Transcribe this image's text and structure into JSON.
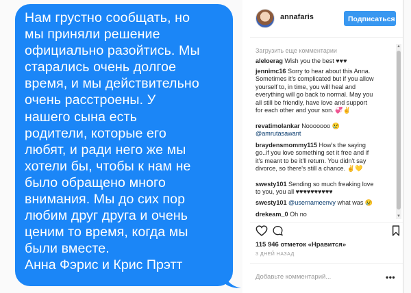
{
  "message": {
    "lines": [
      "Нам грустно сообщать, но",
      "мы приняли решение",
      "официально разойтись. Мы",
      "старались очень долгое",
      "время, и мы действительно",
      "очень расстроены. У",
      "нашего сына есть",
      "родители, которые его",
      "любят, и ради него же мы",
      "хотели бы, чтобы к нам не",
      "было обращено много",
      "внимания. Мы до сих пор",
      "любим друг друга и очень",
      "ценим то время, когда мы",
      "были вместе."
    ],
    "signature": "Анна Фэрис и Крис Прэтт",
    "bubble_color": "#1b86f7"
  },
  "post": {
    "username": "annafaris",
    "follow_label": "Подписаться",
    "load_more": "Загрузить еще комментарии",
    "comments": [
      {
        "user": "aleloerag",
        "lines": [
          "Wish you the best ♥♥♥"
        ]
      },
      {
        "user": "jennimc16",
        "lines": [
          "Sorry to hear about this Anna.",
          "Sometimes it's complicated but if you allow",
          "yourself to, in time, you will heal and",
          "everything will go back to normal. May you",
          "all still be friendly, have love and support",
          "for each other and your son. 💞✌"
        ]
      },
      {
        "user": "revatimolankar",
        "lines": [
          "Nooooooo 😢"
        ],
        "mention": "@amrutasawant"
      },
      {
        "user": "braydensmommy115",
        "lines": [
          "How's the saying",
          "go..if you love something set it free and if",
          "it's meant to be it'll return. You didn't say",
          "divorce, so there's still a chance. ✌💛"
        ]
      },
      {
        "user": "swesty101",
        "lines": [
          "Sending so much freaking love",
          "to you, you all ♥♥♥♥♥♥♥♥♥♥"
        ]
      },
      {
        "user": "swesty101",
        "mention": "@usernameenvy",
        "lines": [
          "what was 😢"
        ]
      },
      {
        "user": "drekeam_0",
        "lines": [
          "Oh no"
        ]
      }
    ],
    "likes": "115 946 отметок «Нравится»",
    "time": "3 ДНЕЙ НАЗАД",
    "add_comment_placeholder": "Добавьте комментарий...",
    "more_label": "•••",
    "accent_color": "#3897f0"
  }
}
